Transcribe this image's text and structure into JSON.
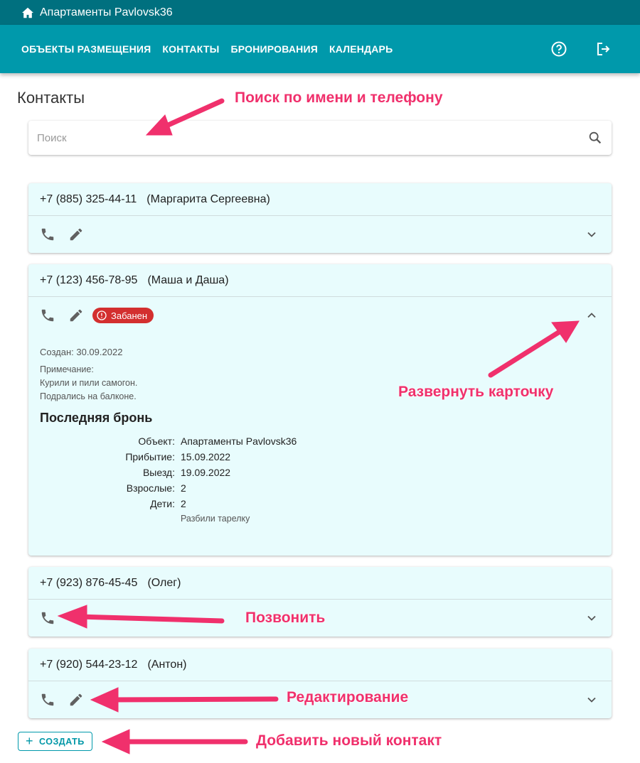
{
  "app": {
    "title": "Апартаменты Pavlovsk36"
  },
  "nav": [
    "ОБЪЕКТЫ РАЗМЕЩЕНИЯ",
    "КОНТАКТЫ",
    "БРОНИРОВАНИЯ",
    "КАЛЕНДАРЬ"
  ],
  "page": {
    "title": "Контакты",
    "search_placeholder": "Поиск"
  },
  "contacts": [
    {
      "phone": "+7 (885) 325-44-11",
      "name": "(Маргарита Сергеевна)"
    },
    {
      "phone": "+7 (123) 456-78-95",
      "name": "(Маша и Даша)",
      "badge": "Забанен",
      "created": "Создан: 30.09.2022",
      "note_label": "Примечание:",
      "note_lines": [
        "Курили и пили самогон.",
        "Подрались на балконе."
      ],
      "last_booking_title": "Последняя бронь",
      "booking": [
        {
          "k": "Объект:",
          "v": "Апартаменты Pavlovsk36"
        },
        {
          "k": "Прибытие:",
          "v": "15.09.2022"
        },
        {
          "k": "Выезд:",
          "v": "19.09.2022"
        },
        {
          "k": "Взрослые:",
          "v": "2"
        },
        {
          "k": "Дети:",
          "v": "2"
        }
      ],
      "booking_comment": "Разбили тарелку"
    },
    {
      "phone": "+7 (923) 876-45-45",
      "name": "(Олег)"
    },
    {
      "phone": "+7 (920) 544-23-12",
      "name": "(Антон)"
    }
  ],
  "create_label": "СОЗДАТЬ",
  "annotations": {
    "search": "Поиск по имени и телефону",
    "expand": "Развернуть карточку",
    "call": "Позвонить",
    "edit": "Редактирование",
    "add": "Добавить новый контакт"
  },
  "colors": {
    "topbar": "#00707f",
    "nav": "#0099ab",
    "card": "#e8fcfd",
    "annotation": "#f0306c",
    "ban": "#d32f2f"
  }
}
